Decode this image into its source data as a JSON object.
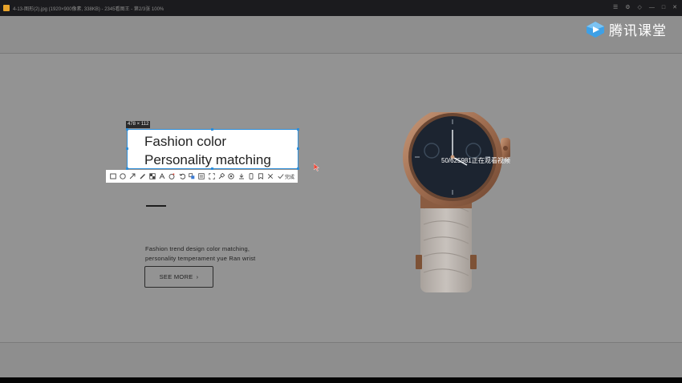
{
  "window": {
    "title": "4-13-图形(2).jpg  (1920×900像素, 338KB)  -  2345看图王 - 第2/3张 100%",
    "controls": [
      "☰",
      "⚙",
      "◇",
      "—",
      "□",
      "✕"
    ]
  },
  "watermark": {
    "text": "腾讯课堂"
  },
  "selection": {
    "size_label": "478 × 112",
    "headline_line1": "Fashion color",
    "headline_line2": "Personality matching"
  },
  "toolbar": {
    "done_label": "完成",
    "tools": [
      "rectangle-tool",
      "ellipse-tool",
      "arrow-tool",
      "pen-tool",
      "mosaic-tool",
      "text-tool",
      "sticker-tool",
      "undo-tool",
      "translate-tool",
      "ocr-tool",
      "screen-record-tool",
      "pin-tool",
      "gif-tool",
      "download-tool",
      "phone-tool",
      "bookmark-tool",
      "close-tool",
      "done-tool"
    ]
  },
  "content": {
    "description_line1": "Fashion trend design color matching,",
    "description_line2": "personality temperament yue Ran wrist",
    "see_more_label": "SEE MORE",
    "see_more_chevron": "›",
    "viewers_text": "50/625981正在观看视频"
  },
  "colors": {
    "selection_border": "#2f8ed8",
    "canvas_dim": "#939393",
    "watch_gold": "#b07b5c",
    "strap": "#bdb7b2",
    "logo_blue": "#3ea0e6"
  }
}
